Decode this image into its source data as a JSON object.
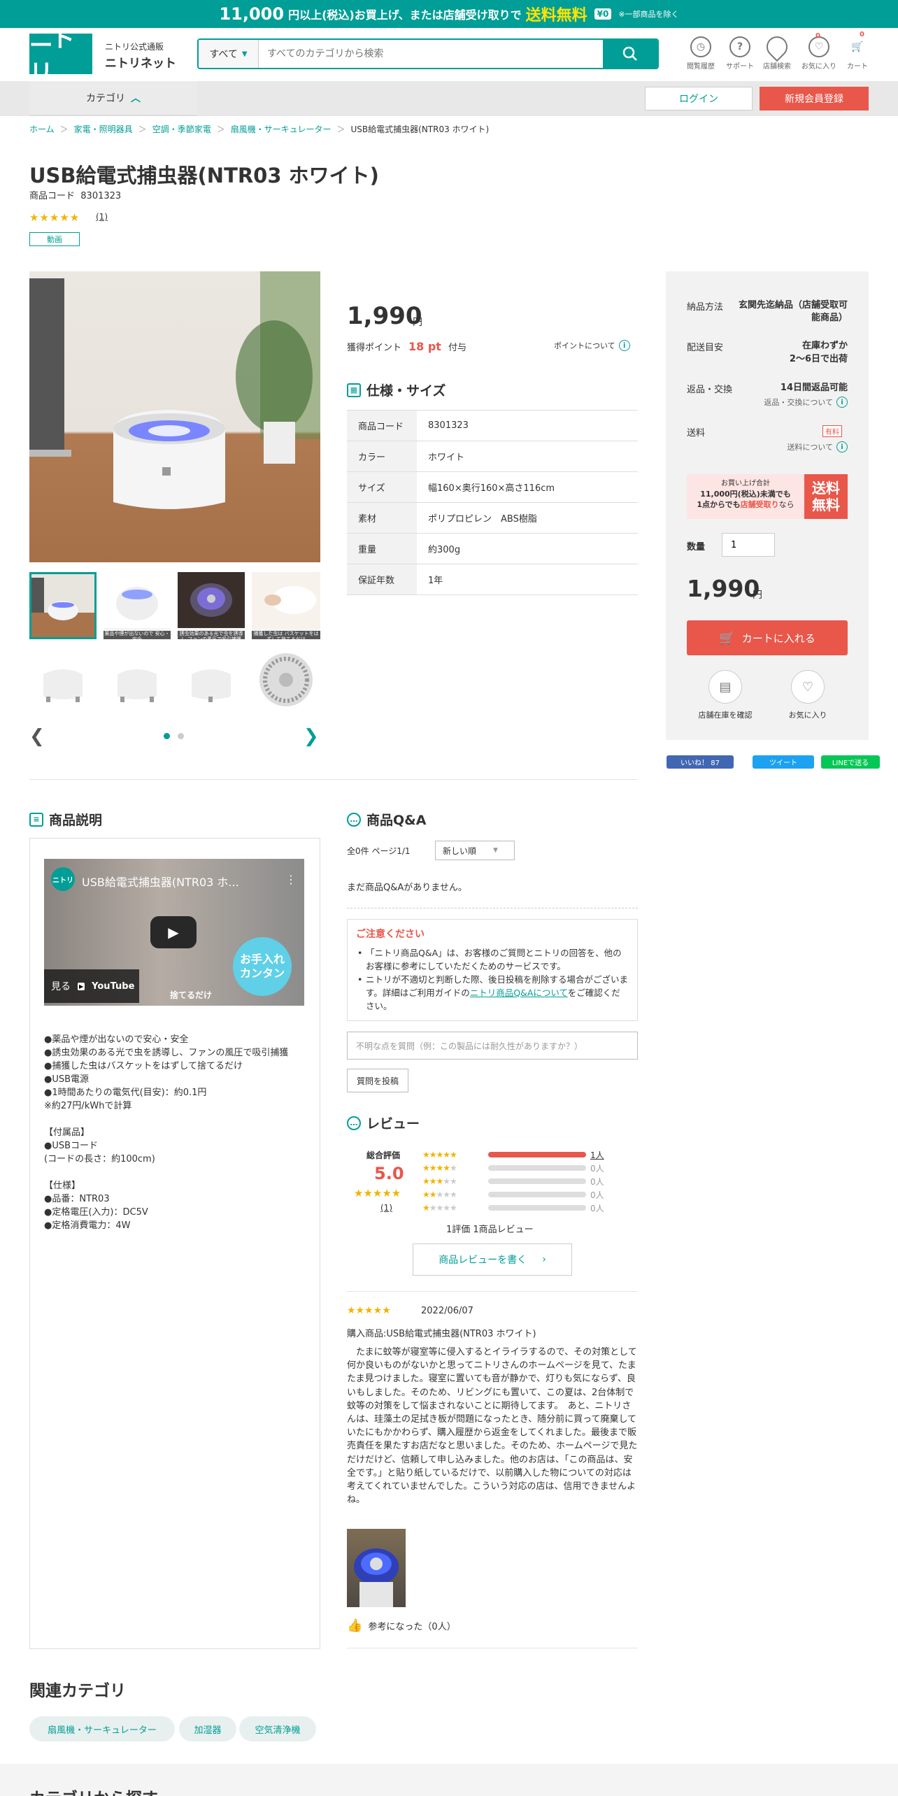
{
  "banner": {
    "amount": "11,000",
    "text1": "円以上(税込)お買上げ、または店舗受け取りで",
    "free": "送料無料",
    "tag": "¥0",
    "note": "※一部商品を除く"
  },
  "header": {
    "brand_small": "ニトリ公式通販",
    "brand_name": "ニトリネット",
    "logo_text": "ニトリ",
    "search_category": "すべて",
    "search_placeholder": "すべてのカテゴリから検索",
    "icons": [
      {
        "label": "閲覧履歴",
        "icon": "clock-icon"
      },
      {
        "label": "サポート",
        "icon": "help-icon"
      },
      {
        "label": "店舗検索",
        "icon": "pin-icon"
      },
      {
        "label": "お気に入り",
        "icon": "heart-icon",
        "badge": "0"
      },
      {
        "label": "カート",
        "icon": "cart-icon",
        "badge": "0"
      }
    ]
  },
  "nav": {
    "category": "カテゴリ",
    "login": "ログイン",
    "register": "新規会員登録"
  },
  "breadcrumb": [
    "ホーム",
    "家電・照明器具",
    "空調・季節家電",
    "扇風機・サーキュレーター",
    "USB給電式捕虫器(NTR03 ホワイト)"
  ],
  "product": {
    "title": "USB給電式捕虫器(NTR03 ホワイト)",
    "code_label": "商品コード",
    "code": "8301323",
    "stars": "★★★★★",
    "rating_count": "(1)",
    "video_tag": "動画",
    "price": "1,990",
    "yen": "円",
    "points_label": "獲得ポイント",
    "points": "18 pt",
    "points_suffix": "付与",
    "point_about": "ポイントについて",
    "thumb_captions": [
      "",
      "薬品や煙が出ないので 安心・安全",
      "誘虫効果のある光で虫を誘導し ファンの風圧で吸引捕獲",
      "捕獲した虫は バスケットをはずして捨てるだけ"
    ]
  },
  "spec": {
    "heading": "仕様・サイズ",
    "rows": [
      {
        "k": "商品コード",
        "v": "8301323"
      },
      {
        "k": "カラー",
        "v": "ホワイト"
      },
      {
        "k": "サイズ",
        "v": "幅160×奥行160×高さ116cm"
      },
      {
        "k": "素材",
        "v": "ポリプロピレン　ABS樹脂"
      },
      {
        "k": "重量",
        "v": "約300g"
      },
      {
        "k": "保証年数",
        "v": "1年"
      }
    ]
  },
  "side": {
    "delivery_label": "納品方法",
    "delivery_value": "玄関先迄納品（店舗受取可能商品）",
    "eta_label": "配送目安",
    "eta_value1": "在庫わずか",
    "eta_value2": "2～6日で出荷",
    "return_label": "返品・交換",
    "return_value": "14日間返品可能",
    "return_about": "返品・交換について",
    "shipping_label": "送料",
    "shipping_tag": "有料",
    "shipping_about": "送料について",
    "free_line1": "お買い上げ合計",
    "free_line2": "11,000円(税込)未満でも",
    "free_line3a": "1点からでも",
    "free_line3b": "店舗受取り",
    "free_line3c": "なら",
    "free_badge1": "送料",
    "free_badge2": "無料",
    "qty_label": "数量",
    "qty_value": "1",
    "price": "1,990",
    "yen": "円",
    "cart": "カートに入れる",
    "store_stock": "店舗在庫を確認",
    "favorite": "お気に入り"
  },
  "share": {
    "like": "いいね！ 87",
    "tweet": "ツイート",
    "line": "LINEで送る"
  },
  "description": {
    "heading": "商品説明",
    "video_title": "USB給電式捕虫器(NTR03 ホ...",
    "video_watch": "見る",
    "video_youtube": "YouTube",
    "video_badge": "お手入れ カンタン",
    "video_caption": "捨てるだけ",
    "text": "●薬品や煙が出ないので安心・安全\n●誘虫効果のある光で虫を誘導し、ファンの風圧で吸引捕獲\n●捕獲した虫はバスケットをはずして捨てるだけ\n●USB電源\n●1時間あたりの電気代(目安)：約0.1円\n※約27円/kWhで計算\n\n【付属品】\n●USBコード\n(コードの長さ：約100cm)\n\n【仕様】\n●品番：NTR03\n●定格電圧(入力)：DC5V\n●定格消費電力：4W"
  },
  "qa": {
    "heading": "商品Q&A",
    "meta": "全0件 ページ1/1",
    "sort": "新しい順",
    "empty": "まだ商品Q&Aがありません。",
    "notice_heading": "ご注意ください",
    "notice1": "「ニトリ商品Q&A」は、お客様のご質問とニトリの回答を、他のお客様に参考にしていただくためのサービスです。",
    "notice2a": "ニトリが不適切と判断した際、後日投稿を削除する場合がございます。詳細はご利用ガイドの",
    "notice2_link": "ニトリ商品Q&Aについて",
    "notice2b": "をご確認ください。",
    "input_placeholder": "不明な点を質問（例：この製品には耐久性がありますか？）",
    "post": "質問を投稿"
  },
  "reviews": {
    "heading": "レビュー",
    "overall_label": "総合評価",
    "overall_score": "5.0",
    "overall_stars": "★★★★★",
    "overall_count": "(1)",
    "distribution": [
      {
        "stars": 5,
        "count": "1人",
        "fraction": 1.0
      },
      {
        "stars": 4,
        "count": "0人",
        "fraction": 0
      },
      {
        "stars": 3,
        "count": "0人",
        "fraction": 0
      },
      {
        "stars": 2,
        "count": "0人",
        "fraction": 0
      },
      {
        "stars": 1,
        "count": "0人",
        "fraction": 0
      }
    ],
    "summary": "1評価 1商品レビュー",
    "write": "商品レビューを書く",
    "item": {
      "stars": "★★★★★",
      "date": "2022/06/07",
      "product": "購入商品:USB給電式捕虫器(NTR03 ホワイト)",
      "body": "　たまに蚊等が寝室等に侵入するとイライラするので、その対策として何か良いものがないかと思ってニトリさんのホームページを見て、たまたま見つけました。寝室に置いても音が静かで、灯りも気にならず、良いもしました。そのため、リビングにも置いて、この夏は、2台体制で蚊等の対策をして悩まされないことに期待してます。　あと、ニトリさんは、珪藻土の足拭き板が問題になったとき、随分前に買って廃棄していたにもかかわらず、購入履歴から返金をしてくれました。最後まで販売責任を果たすお店だなと思いました。そのため、ホームページで見ただけだけど、信頼して申し込みました。他のお店は、「この商品は、安全です。」と貼り紙しているだけで、以前購入した物についての対応は考えてくれていませんでした。こういう対応の店は、信用できませんよね。",
      "helpful": "参考になった（0人）"
    }
  },
  "related": {
    "heading": "関連カテゴリ",
    "chips": [
      "扇風機・サーキュレーター",
      "加湿器",
      "空気清浄機"
    ]
  },
  "bottom": {
    "heading": "カテゴリから探す"
  },
  "colors": {
    "brand": "#009e96",
    "accent": "#e8574a",
    "star": "#f0b400"
  }
}
